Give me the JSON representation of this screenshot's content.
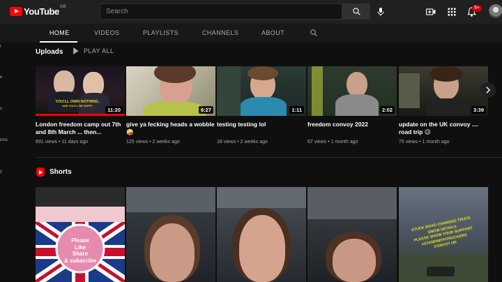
{
  "app": {
    "logo_text": "YouTube",
    "region": "GB"
  },
  "search": {
    "placeholder": "Search"
  },
  "notifications": {
    "badge": "9+"
  },
  "sidebar_cutoff": [
    "r",
    "e",
    "s",
    "ions",
    "y"
  ],
  "tabs": [
    {
      "label": "HOME",
      "active": true
    },
    {
      "label": "VIDEOS",
      "active": false
    },
    {
      "label": "PLAYLISTS",
      "active": false
    },
    {
      "label": "CHANNELS",
      "active": false
    },
    {
      "label": "ABOUT",
      "active": false
    }
  ],
  "uploads": {
    "title": "Uploads",
    "play_all": "PLAY ALL",
    "videos": [
      {
        "title": "London freedom camp out 7th and 8th March ... then...",
        "views": "691 views",
        "age": "11 days ago",
        "duration": "11:20",
        "caption": "YOU'LL OWN NOTHING.",
        "caption2": "AND YOU'LL BE HAPPY"
      },
      {
        "title": "give ya fecking heads a wobble 🤪",
        "views": "125 views",
        "age": "2 weeks ago",
        "duration": "6:27"
      },
      {
        "title": "testing testing lol",
        "views": "18 views",
        "age": "2 weeks ago",
        "duration": "1:11"
      },
      {
        "title": "freedom convoy 2022",
        "views": "67 views",
        "age": "1 month ago",
        "duration": "2:02"
      },
      {
        "title": "update on the UK convoy .... road trip 😉",
        "views": "75 views",
        "age": "1 month ago",
        "duration": "3:39"
      }
    ]
  },
  "shorts": {
    "title": "Shorts",
    "first_overlay": [
      "Please",
      "Like",
      "Share",
      "& subscribe"
    ],
    "last_overlay": [
      "STUCK ROAD CHANGED TRUCK",
      "SNOW DETAILS",
      "PLEASE SHOW YOUR SUPPORT",
      "#STANDWITHTRUCKERS",
      "CONVOY UK"
    ]
  },
  "colors": {
    "accent": "#ff0000",
    "background": "#0f0f0f",
    "topbar": "#202020"
  }
}
